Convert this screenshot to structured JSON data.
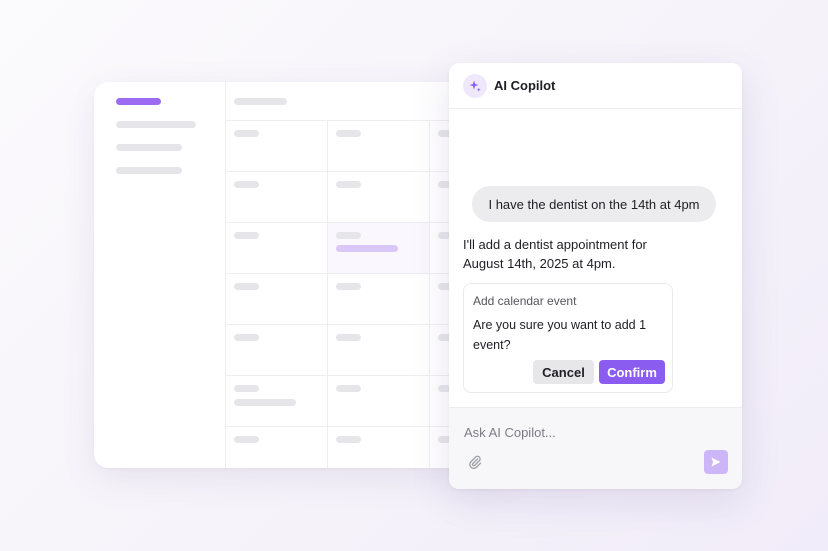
{
  "colors": {
    "accent": "#8b5cf0",
    "accent_soft": "#cdb6f7",
    "skeleton": "#e6e6ea",
    "user_bubble": "#ececee"
  },
  "calendar": {
    "highlighted_cell": {
      "row": 3,
      "col": 2
    }
  },
  "chat": {
    "title": "AI Copilot",
    "logo_icon": "sparkle-icon",
    "messages": [
      {
        "role": "user",
        "text": "I have the dentist on the 14th at 4pm"
      },
      {
        "role": "assistant",
        "text": "I'll add a dentist appointment for August 14th, 2025 at 4pm."
      }
    ],
    "confirm_card": {
      "title": "Add calendar event",
      "body": "Are you sure you want to add 1 event?",
      "cancel_label": "Cancel",
      "confirm_label": "Confirm"
    },
    "composer": {
      "placeholder": "Ask AI Copilot...",
      "value": "",
      "attach_icon": "paperclip-icon",
      "send_icon": "send-icon"
    }
  }
}
